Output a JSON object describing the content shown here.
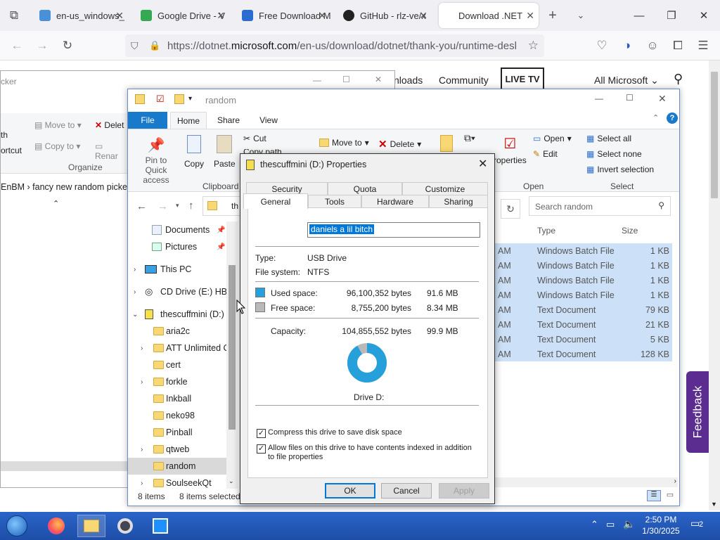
{
  "browser": {
    "tabs": [
      {
        "title": "en-us_windows_",
        "fav": "#4a90d9"
      },
      {
        "title": "Google Drive - V",
        "fav": "#34a853"
      },
      {
        "title": "Free Download M",
        "fav": "#2b6cd0"
      },
      {
        "title": "GitHub - rlz-ve/x",
        "fav": "#222222"
      },
      {
        "title": "Download .NET",
        "fav": "#cccccc"
      }
    ],
    "url_prefix": "https://dotnet.",
    "url_domain": "microsoft.com",
    "url_rest": "/en-us/download/dotnet/thank-you/runtime-deskto"
  },
  "webpage": {
    "downloads": "nloads",
    "community": "Community",
    "livetv": "LIVE TV",
    "allms": "All Microsoft ⌄",
    "feedback": "Feedback"
  },
  "bg_explorer": {
    "title": "cker",
    "moveto": "Move to",
    "copyto": "Copy to",
    "delete": "Delet",
    "rename": "Renar",
    "organize": "Organize",
    "th": "th",
    "ortcut": "ortcut",
    "crumb1": "EnBM",
    "crumb2": "fancy new random picker"
  },
  "explorer": {
    "title": "random",
    "tabs": {
      "file": "File",
      "home": "Home",
      "share": "Share",
      "view": "View"
    },
    "ribbon": {
      "pin": "Pin to Quick access",
      "copy": "Copy",
      "paste": "Paste",
      "cut": "Cut",
      "copypath": "Copy path",
      "clipboard": "Clipboard",
      "moveto": "Move to",
      "delete": "Delete",
      "properties": "roperties",
      "open": "Open",
      "edit": "Edit",
      "opengrp": "Open",
      "selectall": "Select all",
      "selectnone": "Select none",
      "invert": "Invert selection",
      "selectgrp": "Select"
    },
    "address": "th",
    "search": "Search random",
    "cols": {
      "type": "Type",
      "size": "Size"
    },
    "tree": {
      "documents": "Documents",
      "pictures": "Pictures",
      "thispc": "This PC",
      "cddrive": "CD Drive (E:) HBC",
      "drive": "thescuffmini (D:)",
      "aria2c": "aria2c",
      "att": "ATT Unlimited C",
      "cert": "cert",
      "forkle": "forkle",
      "inkball": "Inkball",
      "neko98": "neko98",
      "pinball": "Pinball",
      "qtweb": "qtweb",
      "random": "random",
      "soulseek": "SoulseekQt"
    },
    "files": [
      {
        "d": "AM",
        "t": "Windows Batch File",
        "s": "1 KB"
      },
      {
        "d": "AM",
        "t": "Windows Batch File",
        "s": "1 KB"
      },
      {
        "d": "AM",
        "t": "Windows Batch File",
        "s": "1 KB"
      },
      {
        "d": "AM",
        "t": "Windows Batch File",
        "s": "1 KB"
      },
      {
        "d": "AM",
        "t": "Text Document",
        "s": "79 KB"
      },
      {
        "d": "AM",
        "t": "Text Document",
        "s": "21 KB"
      },
      {
        "d": "AM",
        "t": "Text Document",
        "s": "5 KB"
      },
      {
        "d": "AM",
        "t": "Text Document",
        "s": "128 KB"
      }
    ],
    "status_items": "8 items",
    "status_sel": "8 items selected"
  },
  "dialog": {
    "title": "thescuffmini (D:) Properties",
    "tabs_row1": [
      "Security",
      "Quota",
      "Customize"
    ],
    "tabs_row2": [
      "General",
      "Tools",
      "Hardware",
      "Sharing"
    ],
    "label": "daniels a lil bitch",
    "type_l": "Type:",
    "type_v": "USB Drive",
    "fs_l": "File system:",
    "fs_v": "NTFS",
    "used_l": "Used space:",
    "used_b": "96,100,352 bytes",
    "used_m": "91.6 MB",
    "free_l": "Free space:",
    "free_b": "8,755,200 bytes",
    "free_m": "8.34 MB",
    "cap_l": "Capacity:",
    "cap_b": "104,855,552 bytes",
    "cap_m": "99.9 MB",
    "drive": "Drive D:",
    "compress": "Compress this drive to save disk space",
    "index": "Allow files on this drive to have contents indexed in addition to file properties",
    "ok": "OK",
    "cancel": "Cancel",
    "apply": "Apply",
    "used_fraction": 0.9165,
    "used_color": "#26a0da",
    "free_color": "#b9b9b9"
  },
  "taskbar": {
    "time": "2:50 PM",
    "date": "1/30/2025",
    "notif": "2"
  }
}
